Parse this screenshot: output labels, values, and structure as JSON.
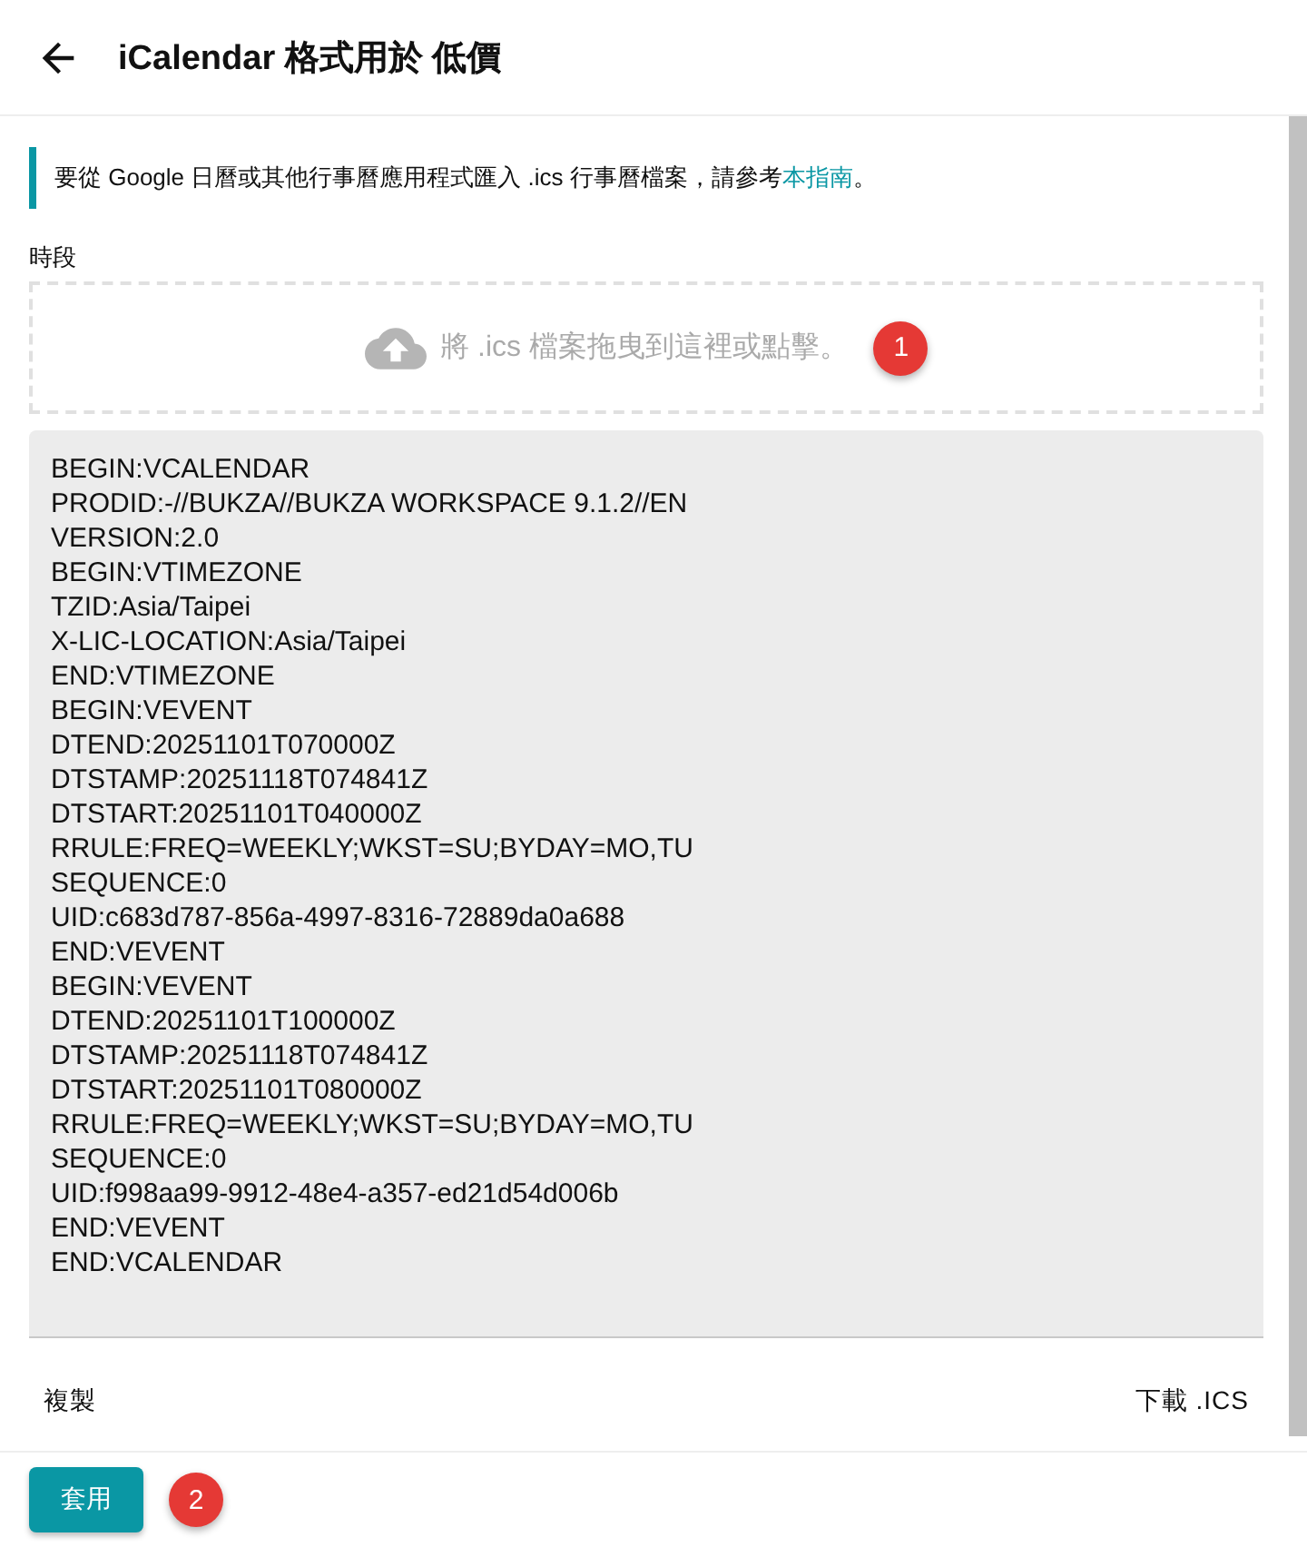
{
  "header": {
    "title": "iCalendar 格式用於 低價"
  },
  "notice": {
    "text": "要從 Google 日曆或其他行事曆應用程式匯入 .ics 行事曆檔案，請參考",
    "link": "本指南",
    "end": "。"
  },
  "field_label": "時段",
  "dropzone": {
    "text": "將 .ics 檔案拖曳到這裡或點擊。",
    "badge": "1"
  },
  "ics_lines": [
    "BEGIN:VCALENDAR",
    "PRODID:-//BUKZA//BUKZA WORKSPACE 9.1.2//EN",
    "VERSION:2.0",
    "BEGIN:VTIMEZONE",
    "TZID:Asia/Taipei",
    "X-LIC-LOCATION:Asia/Taipei",
    "END:VTIMEZONE",
    "BEGIN:VEVENT",
    "DTEND:20251101T070000Z",
    "DTSTAMP:20251118T074841Z",
    "DTSTART:20251101T040000Z",
    "RRULE:FREQ=WEEKLY;WKST=SU;BYDAY=MO,TU",
    "SEQUENCE:0",
    "UID:c683d787-856a-4997-8316-72889da0a688",
    "END:VEVENT",
    "BEGIN:VEVENT",
    "DTEND:20251101T100000Z",
    "DTSTAMP:20251118T074841Z",
    "DTSTART:20251101T080000Z",
    "RRULE:FREQ=WEEKLY;WKST=SU;BYDAY=MO,TU",
    "SEQUENCE:0",
    "UID:f998aa99-9912-48e4-a357-ed21d54d006b",
    "END:VEVENT",
    "END:VCALENDAR"
  ],
  "actions": {
    "copy": "複製",
    "download": "下載 .ICS"
  },
  "footer": {
    "apply": "套用",
    "badge": "2"
  }
}
